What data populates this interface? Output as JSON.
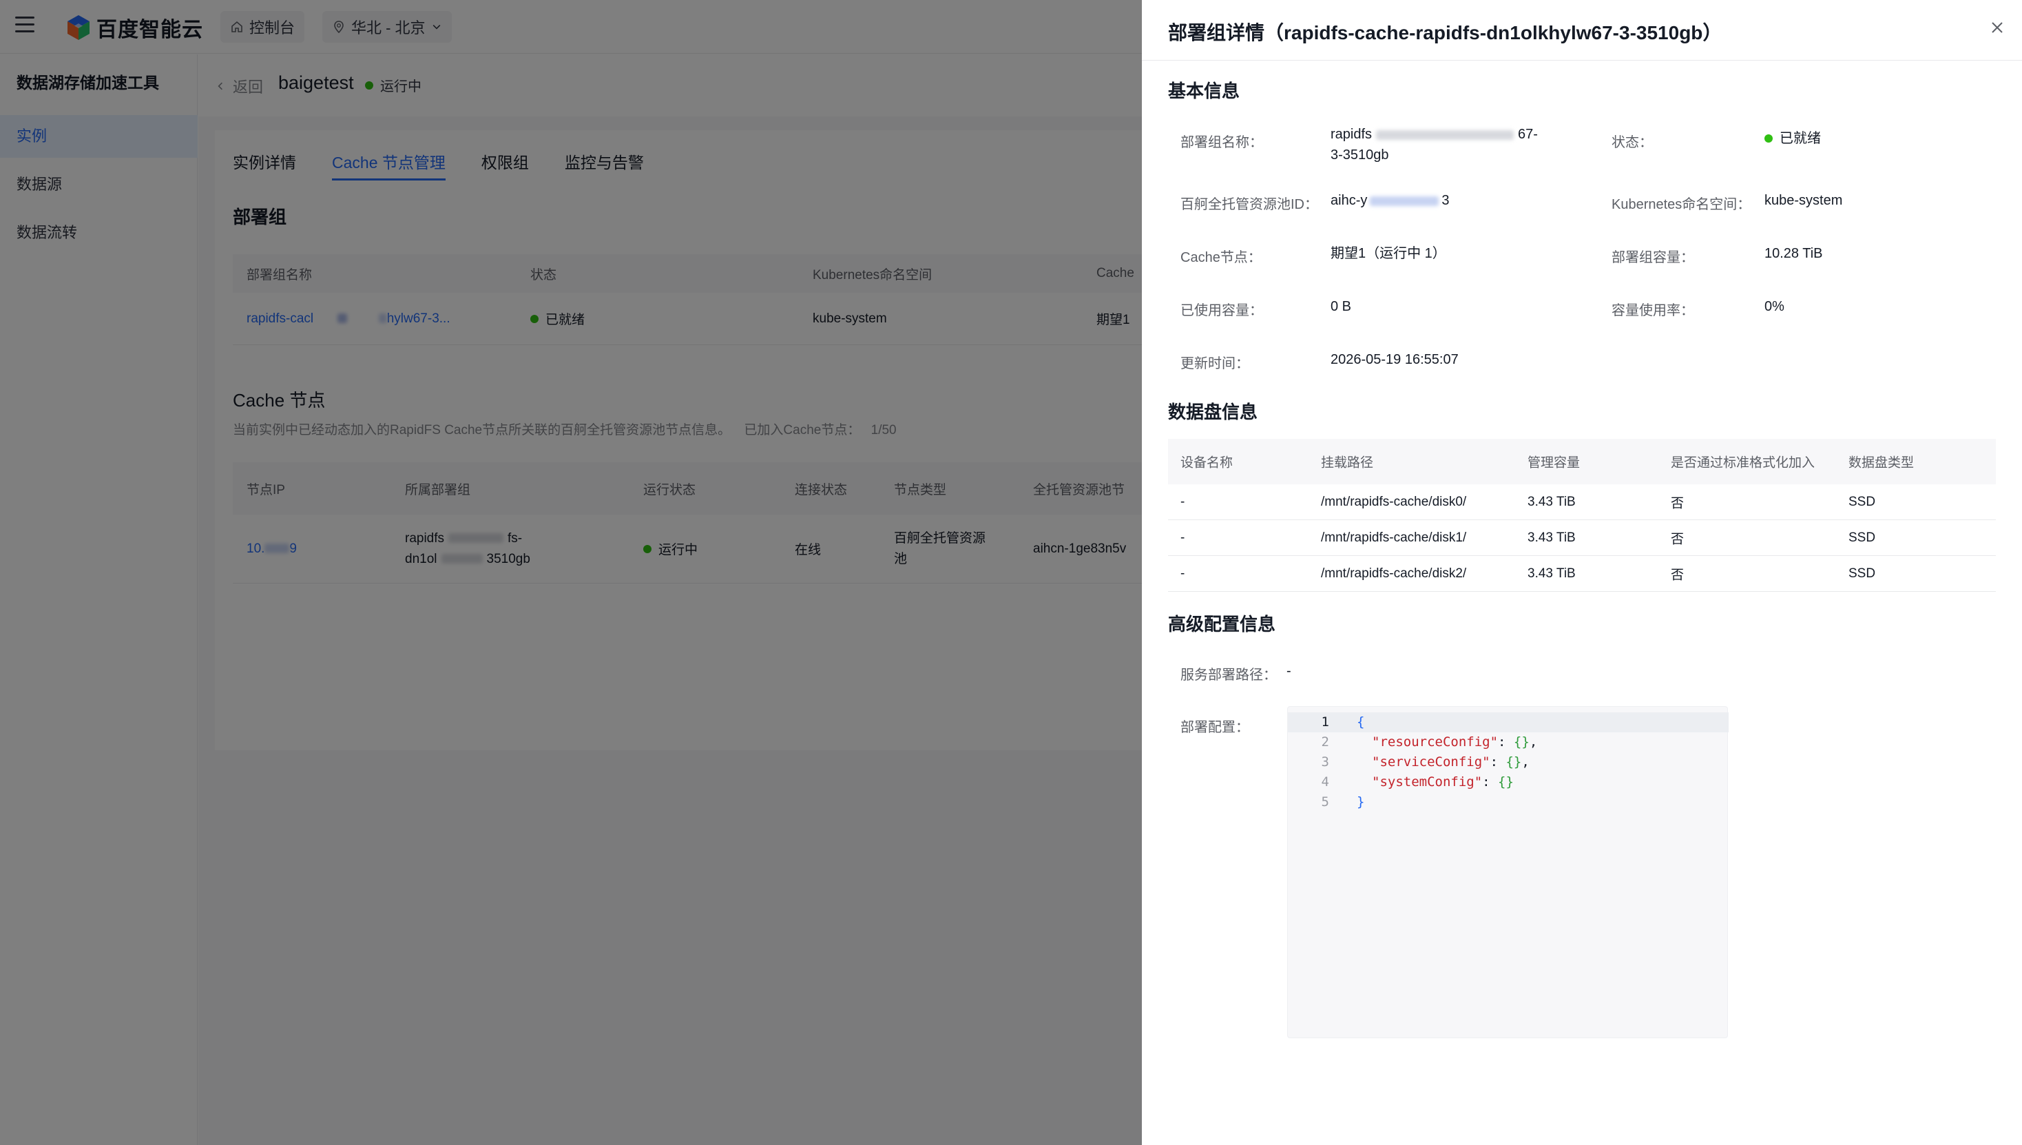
{
  "topbar": {
    "brand": "百度智能云",
    "console": "控制台",
    "region": "华北 - 北京"
  },
  "sidebar": {
    "title": "数据湖存储加速工具",
    "items": [
      {
        "label": "实例",
        "active": true
      },
      {
        "label": "数据源",
        "active": false
      },
      {
        "label": "数据流转",
        "active": false
      }
    ]
  },
  "header": {
    "back": "返回",
    "instance_name": "baigetest",
    "status": "运行中"
  },
  "tabs": [
    "实例详情",
    "Cache 节点管理",
    "权限组",
    "监控与告警"
  ],
  "deploy_group": {
    "title": "部署组",
    "columns": [
      "部署组名称",
      "状态",
      "Kubernetes命名空间",
      "Cache"
    ],
    "row": {
      "name_start": "rapidfs-cacl",
      "name_end": "hylw67-3...",
      "status": "已就绪",
      "namespace": "kube-system",
      "cache": "期望1"
    }
  },
  "cache_nodes": {
    "title": "Cache 节点",
    "desc": "当前实例中已经动态加入的RapidFS Cache节点所关联的百舸全托管资源池节点信息。",
    "joined_label": "已加入Cache节点：",
    "joined_value": "1/50",
    "columns": [
      "节点IP",
      "所属部署组",
      "运行状态",
      "连接状态",
      "节点类型",
      "全托管资源池节"
    ],
    "row": {
      "ip_start": "10.",
      "ip_end": "9",
      "group_line1": "rapidfs",
      "group_line1_end": "fs-",
      "group_line2": "dn1ol",
      "group_line2_end": "3510gb",
      "run_status": "运行中",
      "conn_status": "在线",
      "node_type_line1": "百舸全托管资源",
      "node_type_line2": "池",
      "pool": "aihcn-1ge83n5v"
    }
  },
  "drawer": {
    "title": "部署组详情（rapidfs-cache-rapidfs-dn1olkhylw67-3-3510gb）",
    "basic_title": "基本信息",
    "basic": {
      "name_label": "部署组名称：",
      "name_value_l1_start": "rapidfs",
      "name_value_l1_end": "67-",
      "name_value_l2": "3-3510gb",
      "status_label": "状态：",
      "status_value": "已就绪",
      "pool_label": "百舸全托管资源池ID：",
      "pool_value_start": "aihc-y",
      "pool_value_end": "3",
      "ns_label": "Kubernetes命名空间：",
      "ns_value": "kube-system",
      "cache_label": "Cache节点：",
      "cache_value": "期望1（运行中 1）",
      "capacity_label": "部署组容量：",
      "capacity_value": "10.28 TiB",
      "used_label": "已使用容量：",
      "used_value": "0 B",
      "usage_label": "容量使用率：",
      "usage_value": "0%",
      "updated_label": "更新时间：",
      "updated_value": "2026-05-19 16:55:07"
    },
    "disk_title": "数据盘信息",
    "disk_columns": [
      "设备名称",
      "挂载路径",
      "管理容量",
      "是否通过标准格式化加入",
      "数据盘类型"
    ],
    "disks": [
      {
        "device": "-",
        "path": "/mnt/rapidfs-cache/disk0/",
        "capacity": "3.43 TiB",
        "formatted": "否",
        "type": "SSD"
      },
      {
        "device": "-",
        "path": "/mnt/rapidfs-cache/disk1/",
        "capacity": "3.43 TiB",
        "formatted": "否",
        "type": "SSD"
      },
      {
        "device": "-",
        "path": "/mnt/rapidfs-cache/disk2/",
        "capacity": "3.43 TiB",
        "formatted": "否",
        "type": "SSD"
      }
    ],
    "advanced_title": "高级配置信息",
    "service_path_label": "服务部署路径：",
    "service_path_value": "-",
    "deploy_config_label": "部署配置：",
    "code": {
      "line_numbers": [
        "1",
        "2",
        "3",
        "4",
        "5"
      ],
      "open": "{",
      "k1": "\"resourceConfig\"",
      "k2": "\"serviceConfig\"",
      "k3": "\"systemConfig\"",
      "v": "{}",
      "close": "}"
    }
  }
}
